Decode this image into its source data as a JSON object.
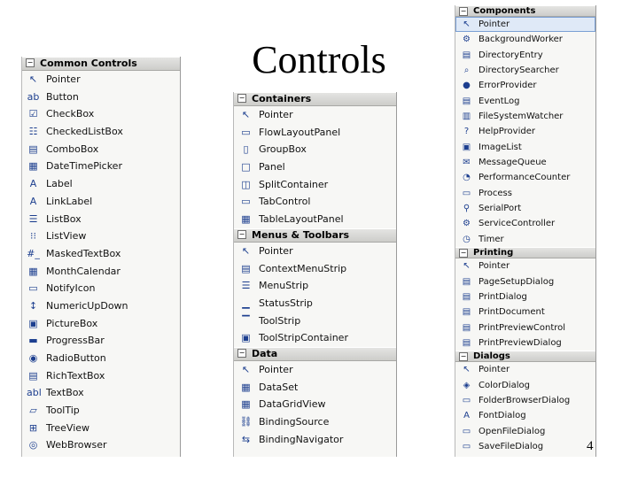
{
  "title": "Controls",
  "page_number": "4",
  "panels": [
    {
      "sections": [
        {
          "header": "Common Controls",
          "items": [
            {
              "label": "Pointer",
              "icon": "pointer-icon",
              "glyph": "↖"
            },
            {
              "label": "Button",
              "icon": "button-icon",
              "glyph": "ab"
            },
            {
              "label": "CheckBox",
              "icon": "checkbox-icon",
              "glyph": "☑"
            },
            {
              "label": "CheckedListBox",
              "icon": "checked-list-box-icon",
              "glyph": "☷"
            },
            {
              "label": "ComboBox",
              "icon": "combobox-icon",
              "glyph": "▤"
            },
            {
              "label": "DateTimePicker",
              "icon": "date-time-picker-icon",
              "glyph": "▦"
            },
            {
              "label": "Label",
              "icon": "label-icon",
              "glyph": "A"
            },
            {
              "label": "LinkLabel",
              "icon": "link-label-icon",
              "glyph": "A"
            },
            {
              "label": "ListBox",
              "icon": "list-box-icon",
              "glyph": "☰"
            },
            {
              "label": "ListView",
              "icon": "list-view-icon",
              "glyph": "⁝⁝"
            },
            {
              "label": "MaskedTextBox",
              "icon": "masked-text-box-icon",
              "glyph": "#_"
            },
            {
              "label": "MonthCalendar",
              "icon": "month-calendar-icon",
              "glyph": "▦"
            },
            {
              "label": "NotifyIcon",
              "icon": "notify-icon",
              "glyph": "▭"
            },
            {
              "label": "NumericUpDown",
              "icon": "numeric-updown-icon",
              "glyph": "↕"
            },
            {
              "label": "PictureBox",
              "icon": "picture-box-icon",
              "glyph": "▣"
            },
            {
              "label": "ProgressBar",
              "icon": "progress-bar-icon",
              "glyph": "▬"
            },
            {
              "label": "RadioButton",
              "icon": "radio-button-icon",
              "glyph": "◉"
            },
            {
              "label": "RichTextBox",
              "icon": "rich-text-box-icon",
              "glyph": "▤"
            },
            {
              "label": "TextBox",
              "icon": "text-box-icon",
              "glyph": "abl"
            },
            {
              "label": "ToolTip",
              "icon": "tooltip-icon",
              "glyph": "▱"
            },
            {
              "label": "TreeView",
              "icon": "tree-view-icon",
              "glyph": "⊞"
            },
            {
              "label": "WebBrowser",
              "icon": "web-browser-icon",
              "glyph": "◎"
            }
          ]
        }
      ]
    },
    {
      "sections": [
        {
          "header": "Containers",
          "items": [
            {
              "label": "Pointer",
              "icon": "pointer-icon",
              "glyph": "↖"
            },
            {
              "label": "FlowLayoutPanel",
              "icon": "flow-layout-panel-icon",
              "glyph": "▭"
            },
            {
              "label": "GroupBox",
              "icon": "group-box-icon",
              "glyph": "▯"
            },
            {
              "label": "Panel",
              "icon": "panel-icon",
              "glyph": "□"
            },
            {
              "label": "SplitContainer",
              "icon": "split-container-icon",
              "glyph": "◫"
            },
            {
              "label": "TabControl",
              "icon": "tab-control-icon",
              "glyph": "▭"
            },
            {
              "label": "TableLayoutPanel",
              "icon": "table-layout-panel-icon",
              "glyph": "▦"
            }
          ]
        },
        {
          "header": "Menus & Toolbars",
          "items": [
            {
              "label": "Pointer",
              "icon": "pointer-icon",
              "glyph": "↖"
            },
            {
              "label": "ContextMenuStrip",
              "icon": "context-menu-strip-icon",
              "glyph": "▤"
            },
            {
              "label": "MenuStrip",
              "icon": "menu-strip-icon",
              "glyph": "☰"
            },
            {
              "label": "StatusStrip",
              "icon": "status-strip-icon",
              "glyph": "▁"
            },
            {
              "label": "ToolStrip",
              "icon": "tool-strip-icon",
              "glyph": "▔"
            },
            {
              "label": "ToolStripContainer",
              "icon": "tool-strip-container-icon",
              "glyph": "▣"
            }
          ]
        },
        {
          "header": "Data",
          "items": [
            {
              "label": "Pointer",
              "icon": "pointer-icon",
              "glyph": "↖"
            },
            {
              "label": "DataSet",
              "icon": "dataset-icon",
              "glyph": "▦"
            },
            {
              "label": "DataGridView",
              "icon": "data-grid-view-icon",
              "glyph": "▦"
            },
            {
              "label": "BindingSource",
              "icon": "binding-source-icon",
              "glyph": "⛓"
            },
            {
              "label": "BindingNavigator",
              "icon": "binding-navigator-icon",
              "glyph": "⇆"
            }
          ]
        }
      ]
    },
    {
      "sections": [
        {
          "header": "Components",
          "items": [
            {
              "label": "Pointer",
              "icon": "pointer-icon",
              "glyph": "↖",
              "selected": true
            },
            {
              "label": "BackgroundWorker",
              "icon": "background-worker-icon",
              "glyph": "⚙"
            },
            {
              "label": "DirectoryEntry",
              "icon": "directory-entry-icon",
              "glyph": "▤"
            },
            {
              "label": "DirectorySearcher",
              "icon": "directory-searcher-icon",
              "glyph": "⌕"
            },
            {
              "label": "ErrorProvider",
              "icon": "error-provider-icon",
              "glyph": "●"
            },
            {
              "label": "EventLog",
              "icon": "event-log-icon",
              "glyph": "▤"
            },
            {
              "label": "FileSystemWatcher",
              "icon": "file-system-watcher-icon",
              "glyph": "▥"
            },
            {
              "label": "HelpProvider",
              "icon": "help-provider-icon",
              "glyph": "?"
            },
            {
              "label": "ImageList",
              "icon": "image-list-icon",
              "glyph": "▣"
            },
            {
              "label": "MessageQueue",
              "icon": "message-queue-icon",
              "glyph": "✉"
            },
            {
              "label": "PerformanceCounter",
              "icon": "performance-counter-icon",
              "glyph": "◔"
            },
            {
              "label": "Process",
              "icon": "process-icon",
              "glyph": "▭"
            },
            {
              "label": "SerialPort",
              "icon": "serial-port-icon",
              "glyph": "⚲"
            },
            {
              "label": "ServiceController",
              "icon": "service-controller-icon",
              "glyph": "⚙"
            },
            {
              "label": "Timer",
              "icon": "timer-icon",
              "glyph": "◷"
            }
          ]
        },
        {
          "header": "Printing",
          "items": [
            {
              "label": "Pointer",
              "icon": "pointer-icon",
              "glyph": "↖"
            },
            {
              "label": "PageSetupDialog",
              "icon": "page-setup-dialog-icon",
              "glyph": "▤"
            },
            {
              "label": "PrintDialog",
              "icon": "print-dialog-icon",
              "glyph": "▤"
            },
            {
              "label": "PrintDocument",
              "icon": "print-document-icon",
              "glyph": "▤"
            },
            {
              "label": "PrintPreviewControl",
              "icon": "print-preview-control-icon",
              "glyph": "▤"
            },
            {
              "label": "PrintPreviewDialog",
              "icon": "print-preview-dialog-icon",
              "glyph": "▤"
            }
          ]
        },
        {
          "header": "Dialogs",
          "items": [
            {
              "label": "Pointer",
              "icon": "pointer-icon",
              "glyph": "↖"
            },
            {
              "label": "ColorDialog",
              "icon": "color-dialog-icon",
              "glyph": "◈"
            },
            {
              "label": "FolderBrowserDialog",
              "icon": "folder-browser-dialog-icon",
              "glyph": "▭"
            },
            {
              "label": "FontDialog",
              "icon": "font-dialog-icon",
              "glyph": "A"
            },
            {
              "label": "OpenFileDialog",
              "icon": "open-file-dialog-icon",
              "glyph": "▭"
            },
            {
              "label": "SaveFileDialog",
              "icon": "save-file-dialog-icon",
              "glyph": "▭"
            }
          ]
        }
      ]
    }
  ]
}
